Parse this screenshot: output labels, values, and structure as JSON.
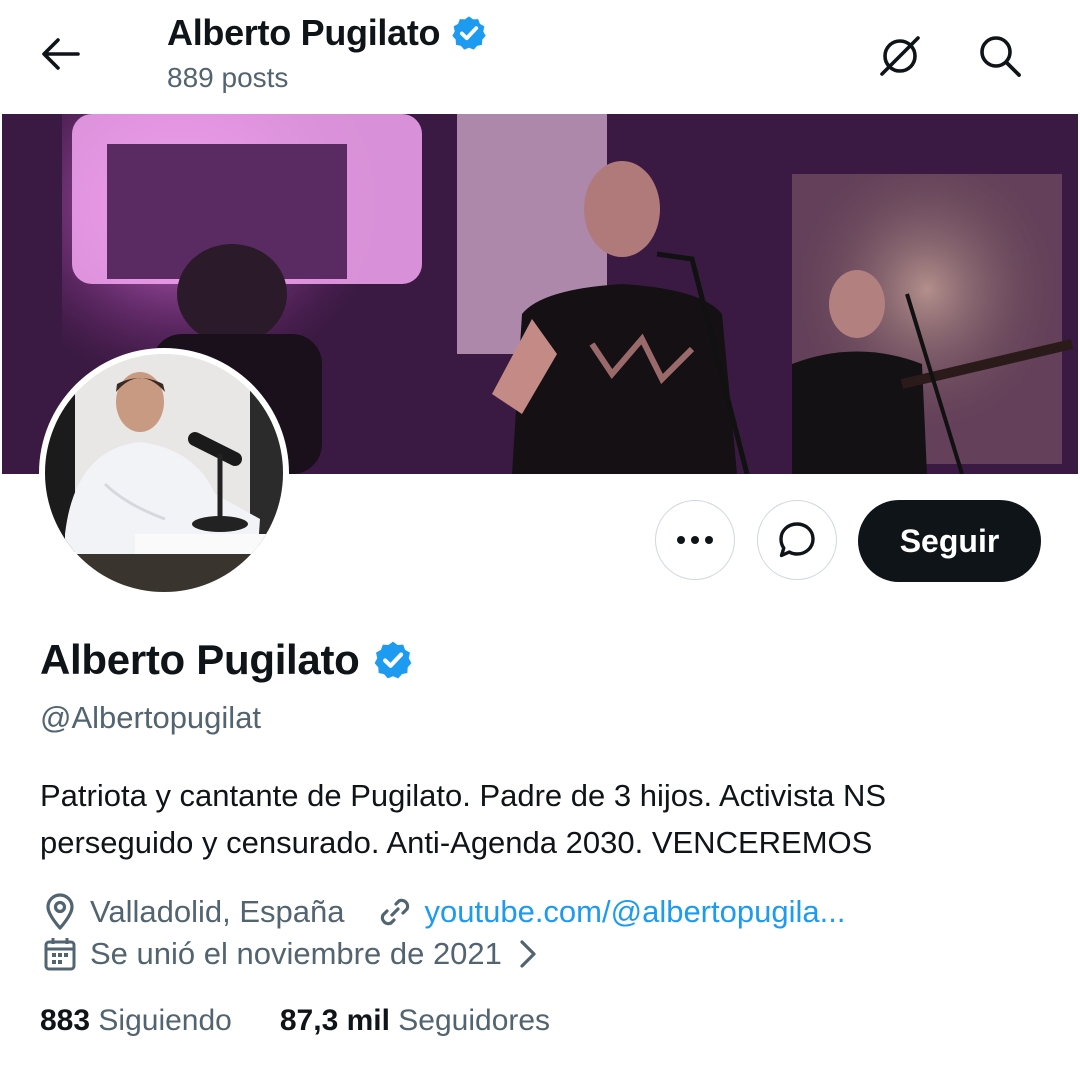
{
  "header": {
    "title": "Alberto Pugilato",
    "posts": "889 posts"
  },
  "profile": {
    "name": "Alberto Pugilato",
    "handle": "@Albertopugilat",
    "bio_line1": "Patriota y cantante de Pugilato. Padre de 3 hijos. Activista NS",
    "bio_line2": "perseguido y censurado. Anti-Agenda 2030. VENCEREMOS",
    "location": "Valladolid, España",
    "website": "youtube.com/@albertopugila...",
    "joined": "Se unió el noviembre de 2021",
    "following_count": "883",
    "following_label": "Siguiendo",
    "followers_count": "87,3 mil",
    "followers_label": "Seguidores",
    "verified": true
  },
  "actions": {
    "follow_label": "Seguir"
  },
  "icons": [
    "back-arrow-icon",
    "verified-badge-icon",
    "translate-off-icon",
    "search-icon",
    "more-icon",
    "message-icon",
    "location-icon",
    "link-icon",
    "calendar-icon",
    "chevron-right-icon"
  ],
  "colors": {
    "accent": "#1d9bf0",
    "text": "#0f1419",
    "secondary": "#536471",
    "button_dark": "#0f1419"
  }
}
